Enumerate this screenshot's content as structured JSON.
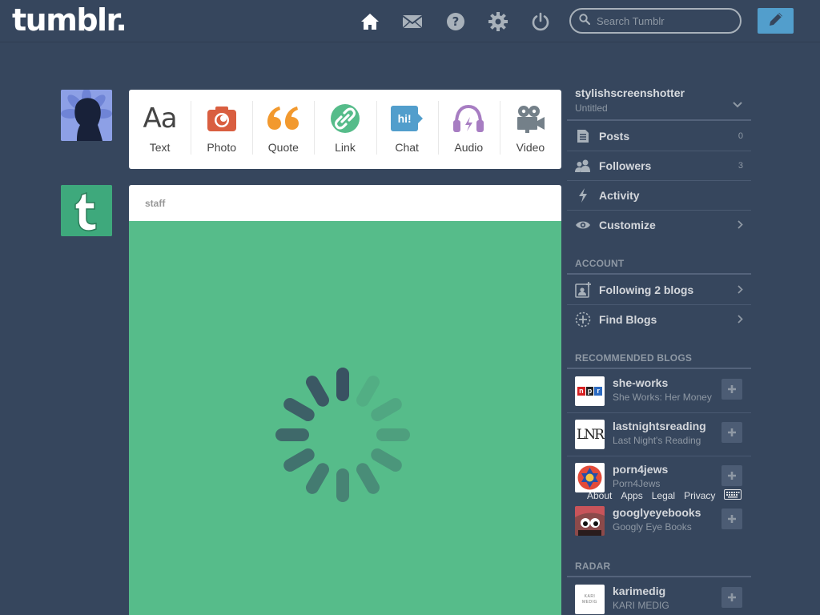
{
  "header": {
    "logo": "tumblr.",
    "search_placeholder": "Search Tumblr",
    "icons": [
      "home-icon",
      "mail-icon",
      "help-icon",
      "gear-icon",
      "power-icon"
    ],
    "compose_icon": "pencil-icon"
  },
  "post_types": [
    {
      "label": "Aa",
      "name": "Text",
      "color": "#444444"
    },
    {
      "label": "",
      "name": "Photo",
      "color": "#d95e40"
    },
    {
      "label": "",
      "name": "Quote",
      "color": "#f2992e"
    },
    {
      "label": "",
      "name": "Link",
      "color": "#56bc8a"
    },
    {
      "label": "hi!",
      "name": "Chat",
      "color": "#529ecc"
    },
    {
      "label": "",
      "name": "Audio",
      "color": "#a77dc2"
    },
    {
      "label": "",
      "name": "Video",
      "color": "#748089"
    }
  ],
  "post": {
    "author": "staff"
  },
  "sidebar": {
    "blog_name": "stylishscreenshotter",
    "blog_title": "Untitled",
    "items": [
      {
        "label": "Posts",
        "count": "0"
      },
      {
        "label": "Followers",
        "count": "3"
      },
      {
        "label": "Activity"
      },
      {
        "label": "Customize"
      }
    ],
    "account_title": "ACCOUNT",
    "account_items": [
      {
        "label": "Following 2 blogs"
      },
      {
        "label": "Find Blogs"
      }
    ],
    "recommended_title": "RECOMMENDED BLOGS",
    "recommended": [
      {
        "name": "she-works",
        "sub": "She Works: Her Money"
      },
      {
        "name": "lastnightsreading",
        "sub": "Last Night's Reading"
      },
      {
        "name": "porn4jews",
        "sub": "Porn4Jews"
      },
      {
        "name": "googlyeyebooks",
        "sub": "Googly Eye Books"
      }
    ],
    "npr_logo": [
      "n",
      "p",
      "r"
    ],
    "lnr_logo": "LNR",
    "radar_title": "RADAR",
    "radar": {
      "name": "karimedig",
      "sub": "KARI MEDIG"
    },
    "radar_logo": [
      "KARI",
      "MEDIG"
    ]
  },
  "footer": [
    "About",
    "Apps",
    "Legal",
    "Privacy"
  ],
  "colors": {
    "background": "#36465d",
    "accent": "#529ecc",
    "post_bg": "#56bc8a",
    "spinner": "#36465d"
  }
}
